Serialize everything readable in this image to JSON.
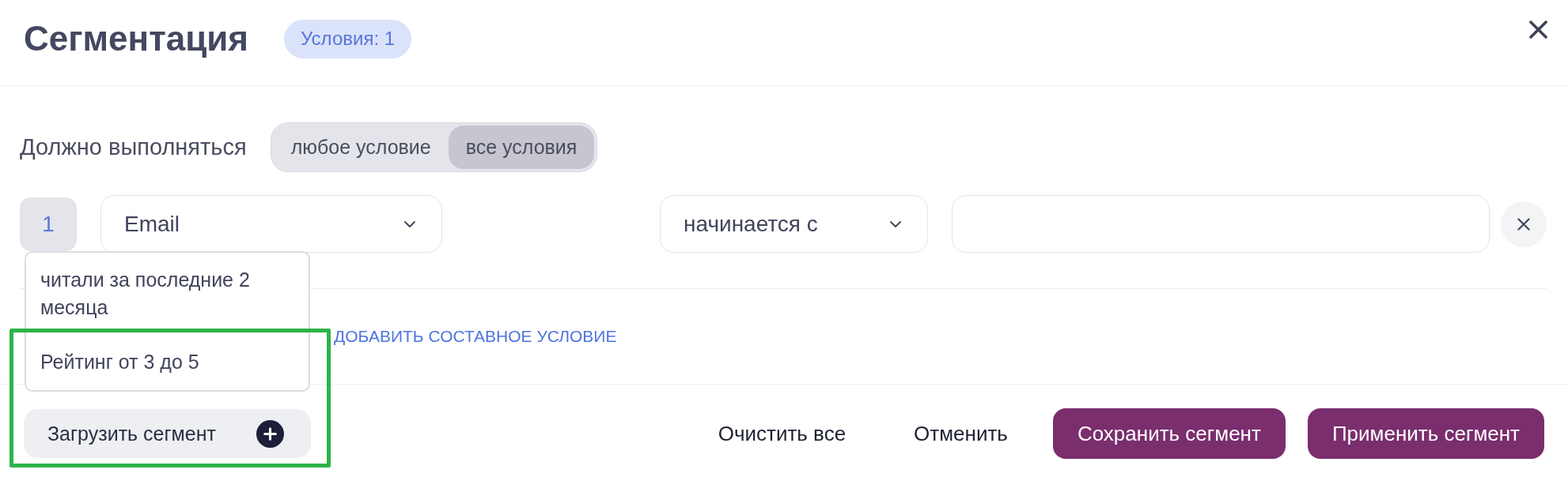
{
  "header": {
    "title": "Сегментация",
    "badge": "Условия: 1"
  },
  "match": {
    "label": "Должно выполняться",
    "options": [
      {
        "label": "любое условие",
        "selected": false
      },
      {
        "label": "все условия",
        "selected": true
      }
    ]
  },
  "conditions": [
    {
      "number": "1",
      "field": "Email",
      "operator": "начинается с"
    }
  ],
  "field_menu": {
    "items": [
      "читали за последние 2 месяца",
      "Рейтинг от 3 до 5"
    ]
  },
  "links": [
    "ДОБАВИТЬ СОСТАВНОЕ УСЛОВИЕ"
  ],
  "footer": {
    "load_button": "Загрузить сегмент",
    "actions": [
      {
        "label": "Очистить все",
        "kind": "text"
      },
      {
        "label": "Отменить",
        "kind": "text"
      },
      {
        "label": "Сохранить сегмент",
        "kind": "primary"
      },
      {
        "label": "Применить сегмент",
        "kind": "primary"
      }
    ]
  }
}
